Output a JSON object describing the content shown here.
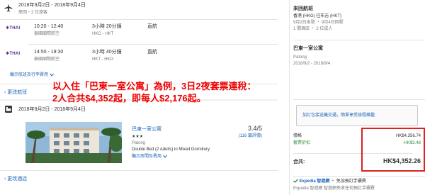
{
  "flight": {
    "dates": "2018年9月2日 - 2018年9月4日",
    "travelers": "來回・2 位旅客",
    "legs": [
      {
        "time": "10:20 - 12:40",
        "airline": "泰國國際航空",
        "duration": "3小時 20分鐘",
        "route": "HKG - HKT",
        "stops": "直航"
      },
      {
        "time": "14:50 - 19:30",
        "airline": "泰國國際航空",
        "duration": "3小時 40分鐘",
        "route": "HKT - HKG",
        "stops": "直航"
      }
    ],
    "details_link": "顯示航班及行李費用",
    "change_link": "更改航班"
  },
  "hotel": {
    "dates": "2018年9月2日 - 2018年9月4日",
    "name": "巴東一室公寓",
    "stars": "★★★",
    "area": "Patong",
    "room": "Double Bed (2 Adults) in Mixed Dormitory",
    "details_link": "顯示房間及費用",
    "rating": "3.4/5",
    "reviews": "(116 篇評價)",
    "change_link": "更改酒店"
  },
  "annotation": {
    "line1": "以入住「巴東一室公寓」為例，3日2夜套票連稅：",
    "line2": "2人合共$4,352起，即每人$2,176起。"
  },
  "summary": {
    "flight_title": "來回航班",
    "flight_route": "香港 (HKG) 往布吉 (HKT)",
    "flight_dates": "9月2日出發 ・ 9月4日回程",
    "flight_pax": "1 間酒店 ・ 2 位成人",
    "hotel_title": "巴東一室公寓",
    "hotel_area": "Patong",
    "hotel_dates": "2018/9/2 - 2018/9/4",
    "transfer_button": "加訂包接送機交通，簡單享受旅程樂趣",
    "price_label": "價格",
    "price_value": "HK$4,356.74",
    "discount_label": "套票折扣",
    "discount_value": "-HK$3.48",
    "total_label": "合共:",
    "total_value": "HK$4,352.26",
    "expedia_title": "Expedia 智遊網",
    "expedia_title_suffix": "・ 免加預訂手續費",
    "expedia_sub": "Expedia 智遊網 智遊網免收任何預訂手續費"
  },
  "colors": {
    "annotation": "#ee0000",
    "link": "#1a64b8",
    "check": "#2e8b3a",
    "thai_logo": "#5b2a86",
    "highlight_border": "#e02020"
  },
  "icons": {
    "flight": "airplane-icon",
    "hotel": "hotel-bed-icon",
    "dropdown": "chevron-down-icon",
    "check": "check-icon"
  }
}
